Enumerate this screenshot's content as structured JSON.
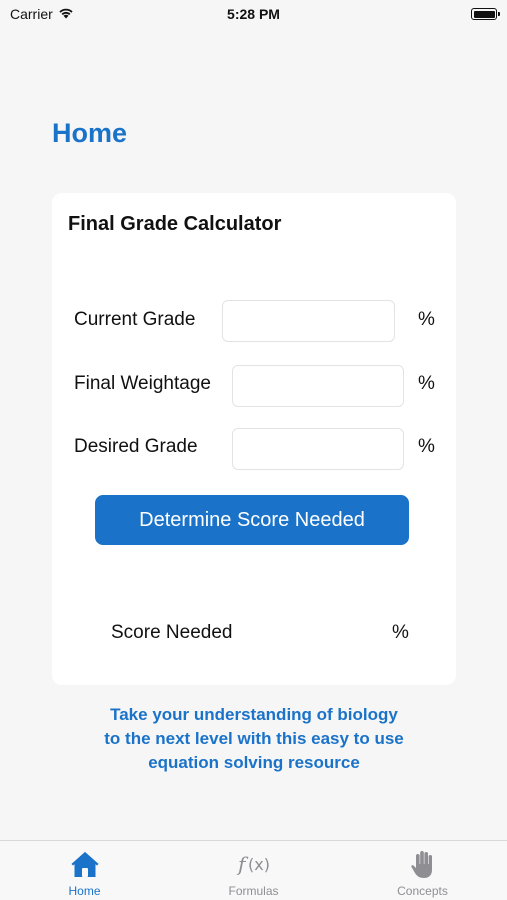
{
  "status_bar": {
    "carrier": "Carrier",
    "time": "5:28 PM",
    "icons": [
      "wifi-icon",
      "battery-icon"
    ]
  },
  "header": {
    "title": "Home"
  },
  "calculator": {
    "title": "Final Grade Calculator",
    "fields": [
      {
        "label": "Current Grade",
        "value": "",
        "unit": "%"
      },
      {
        "label": "Final Weightage",
        "value": "",
        "unit": "%"
      },
      {
        "label": "Desired Grade",
        "value": "",
        "unit": "%"
      }
    ],
    "button_label": "Determine Score Needed",
    "result": {
      "label": "Score Needed",
      "value": "",
      "unit": "%"
    }
  },
  "promo_lines": [
    "Take your understanding of biology",
    "to the next level with this easy to use",
    "equation solving resource"
  ],
  "tab_bar": {
    "tabs": [
      {
        "label": "Home",
        "icon": "house-icon",
        "active": true
      },
      {
        "label": "Formulas",
        "icon": "function-icon",
        "active": false
      },
      {
        "label": "Concepts",
        "icon": "hand-icon",
        "active": false
      }
    ]
  },
  "colors": {
    "accent": "#1a73c9",
    "background": "#f6f6f6",
    "card": "#ffffff",
    "tab_inactive": "#8e8e93"
  }
}
